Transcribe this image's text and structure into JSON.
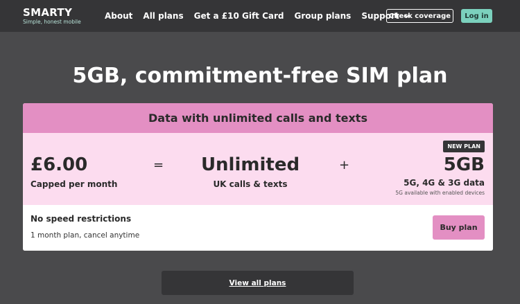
{
  "nav": {
    "logo": {
      "word": "SMARTY",
      "tagline": "Simple, honest mobile"
    },
    "links": [
      "About",
      "All plans",
      "Get a £10 Gift Card",
      "Group plans",
      "Support"
    ],
    "support_icon": "chevron-down-icon",
    "check_coverage_label": "Check coverage",
    "login_label": "Log in"
  },
  "hero": {
    "title": "5GB, commitment-free SIM plan"
  },
  "plan": {
    "header": "Data with unlimited calls and texts",
    "price": "£6.00",
    "price_sub": "Capped per month",
    "equals": "=",
    "calls": "Unlimited",
    "calls_sub": "UK calls & texts",
    "plus": "+",
    "badge": "NEW PLAN",
    "data_amount": "5GB",
    "data_sub": "5G, 4G & 3G data",
    "data_note": "5G available with enabled devices",
    "feature": "No speed restrictions",
    "terms": "1 month plan, cancel anytime",
    "buy_label": "Buy plan"
  },
  "view_all_label": "View all plans",
  "colors": {
    "background": "#4a4a4c",
    "navbar": "#353537",
    "accent_pink": "#e38fc3",
    "light_pink": "#fcdcef",
    "mint": "#7bd1bd"
  }
}
